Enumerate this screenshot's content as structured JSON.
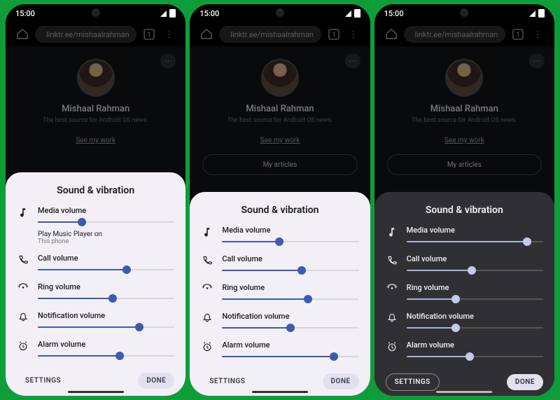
{
  "status": {
    "time": "15:00"
  },
  "browser": {
    "url": "linktr.ee/mishaalrahman"
  },
  "page": {
    "name": "Mishaal Rahman",
    "tagline": "The best source for Android OS news.",
    "see_link": "See my work",
    "chip_label": "My articles"
  },
  "panel_title": "Sound & vibration",
  "settings_label": "SETTINGS",
  "done_label": "DONE",
  "media_sub": {
    "line1": "Play Music Player on",
    "line2": "This phone"
  },
  "sliders": {
    "media": {
      "label": "Media volume",
      "icon": "music"
    },
    "call": {
      "label": "Call volume",
      "icon": "phone"
    },
    "ring": {
      "label": "Ring volume",
      "icon": "ring"
    },
    "notification": {
      "label": "Notification volume",
      "icon": "bell"
    },
    "alarm": {
      "label": "Alarm volume",
      "icon": "alarm"
    }
  },
  "phones": [
    {
      "theme": "light",
      "height_pct": 57,
      "show_media_sub": true,
      "values": {
        "media": 32,
        "call": 65,
        "ring": 55,
        "notification": 74,
        "alarm": 60
      }
    },
    {
      "theme": "light",
      "height_pct": 52,
      "show_media_sub": false,
      "values": {
        "media": 42,
        "call": 58,
        "ring": 63,
        "notification": 50,
        "alarm": 82
      }
    },
    {
      "theme": "dark",
      "height_pct": 52,
      "show_media_sub": false,
      "values": {
        "media": 88,
        "call": 48,
        "ring": 36,
        "notification": 36,
        "alarm": 46
      }
    }
  ],
  "slider_order": [
    "media",
    "call",
    "ring",
    "notification",
    "alarm"
  ]
}
